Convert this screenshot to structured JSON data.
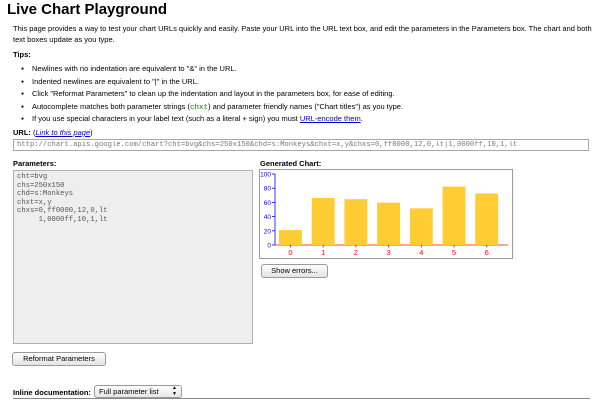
{
  "page": {
    "title": "Live Chart Playground",
    "intro": "This page provides a way to test your chart URLs quickly and easily. Paste your URL into the URL text box, and edit the parameters in the Parameters box. The chart and both text boxes update as you type."
  },
  "tips": {
    "heading": "Tips:",
    "items": [
      {
        "text": "Newlines with no indentation are equivalent to \"&\" in the URL."
      },
      {
        "text": "Indented newlines are equivalent to \"|\" in the URL."
      },
      {
        "text": "Click \"Reformat Parameters\" to clean up the indentation and layout in the parameters box, for ease of editing."
      },
      {
        "pre": "Autocomplete matches both parameter strings (",
        "code": "chxt",
        "post": ") and parameter friendly names (\"Chart titles\") as you type."
      },
      {
        "pre": "If you use special characters in your label text (such as a literal + sign) you must ",
        "link": "URL-encode them",
        "post": "."
      }
    ]
  },
  "url": {
    "label": "URL:",
    "link_open": "(",
    "link_text": "Link to this page",
    "link_close": ")",
    "value": "http://chart.apis.google.com/chart?cht=bvg&chs=250x150&chd=s:Monkeys&chxt=x,y&chxs=0,ff0000,12,0,lt|1,0000ff,10,1,lt"
  },
  "parameters": {
    "heading": "Parameters:",
    "value": "cht=bvg\nchs=250x150\nchd=s:Monkeys\nchxt=x,y\nchxs=0,ff0000,12,0,lt\n     1,0000ff,10,1,lt"
  },
  "generated_chart": {
    "heading": "Generated Chart:",
    "show_errors_label": "Show errors..."
  },
  "chart_data": {
    "type": "bar",
    "categories": [
      "0",
      "1",
      "2",
      "3",
      "4",
      "5",
      "6"
    ],
    "values": [
      20.97,
      66.13,
      64.52,
      59.68,
      51.61,
      82.26,
      72.58
    ],
    "ylim": [
      0,
      100
    ],
    "yticks": [
      0,
      20,
      40,
      60,
      80,
      100
    ],
    "bar_color": "#FFCC33",
    "x_axis_color": "#ff0000",
    "y_axis_color": "#0000ff",
    "grid": false,
    "title": "",
    "xlabel": "",
    "ylabel": ""
  },
  "buttons": {
    "reformat_label": "Reformat Parameters"
  },
  "inline_doc": {
    "label": "Inline documentation:",
    "selected": "Full parameter list"
  }
}
